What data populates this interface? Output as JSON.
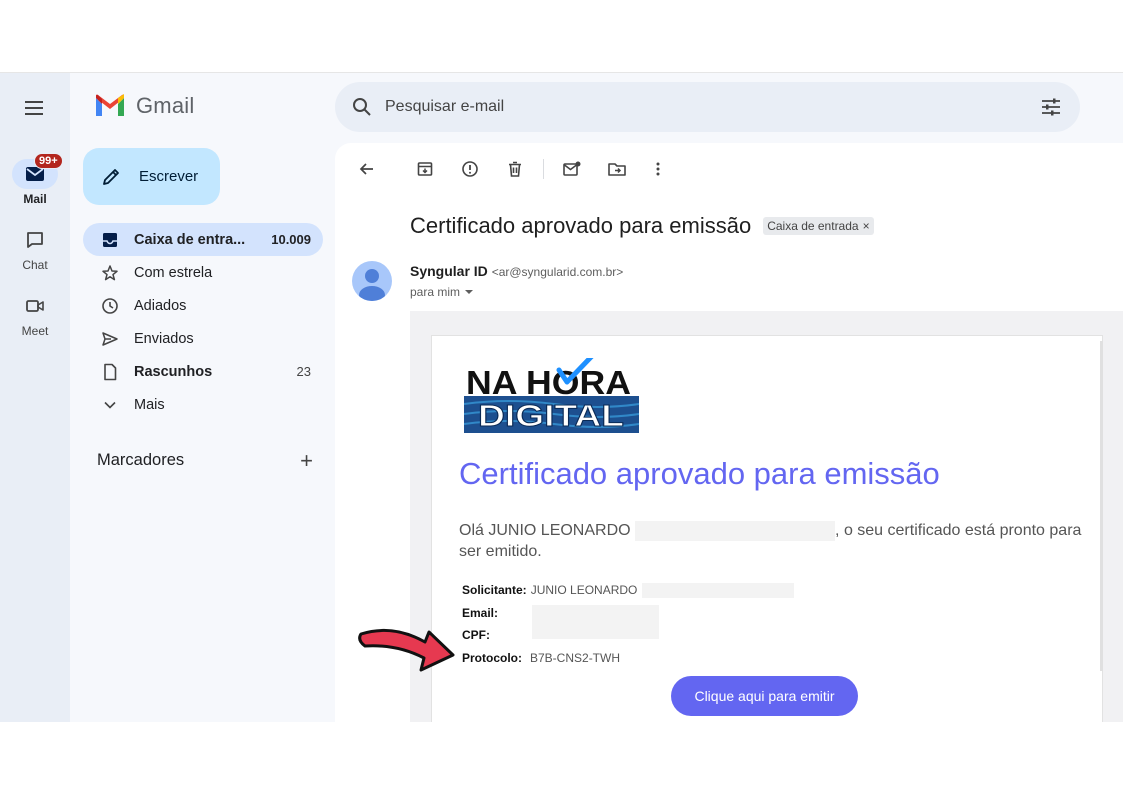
{
  "rail": {
    "mail_label": "Mail",
    "mail_badge": "99+",
    "chat_label": "Chat",
    "meet_label": "Meet"
  },
  "sidebar": {
    "app_name": "Gmail",
    "compose_label": "Escrever",
    "items": [
      {
        "label": "Caixa de entra...",
        "count": "10.009"
      },
      {
        "label": "Com estrela",
        "count": ""
      },
      {
        "label": "Adiados",
        "count": ""
      },
      {
        "label": "Enviados",
        "count": ""
      },
      {
        "label": "Rascunhos",
        "count": "23"
      },
      {
        "label": "Mais",
        "count": ""
      }
    ],
    "labels_heading": "Marcadores",
    "labels_add": "+"
  },
  "search": {
    "placeholder": "Pesquisar e-mail"
  },
  "message": {
    "subject": "Certificado aprovado para emissão",
    "folder_chip": "Caixa de entrada",
    "chip_close": "×",
    "sender_name": "Syngular ID",
    "sender_email": "<ar@syngularid.com.br>",
    "recipient": "para mim"
  },
  "email_body": {
    "brand_line1": "NA HORA",
    "brand_line2": "DIGITAL",
    "title": "Certificado aprovado para emissão",
    "greeting_start": "Olá JUNIO LEONARDO",
    "greeting_end": ", o seu certificado está pronto para ser emitido.",
    "fields": {
      "solicitante_label": "Solicitante:",
      "solicitante_value": "JUNIO LEONARDO",
      "email_label": "Email:",
      "cpf_label": "CPF:",
      "protocolo_label": "Protocolo:",
      "protocolo_value": "B7B-CNS2-TWH"
    },
    "cta_label": "Clique aqui para emitir"
  },
  "colors": {
    "accent": "#6366f1",
    "compose_bg": "#c2e7ff",
    "active_nav": "#d3e3fd",
    "badge": "#b3261e",
    "arrow": "#e63950"
  }
}
